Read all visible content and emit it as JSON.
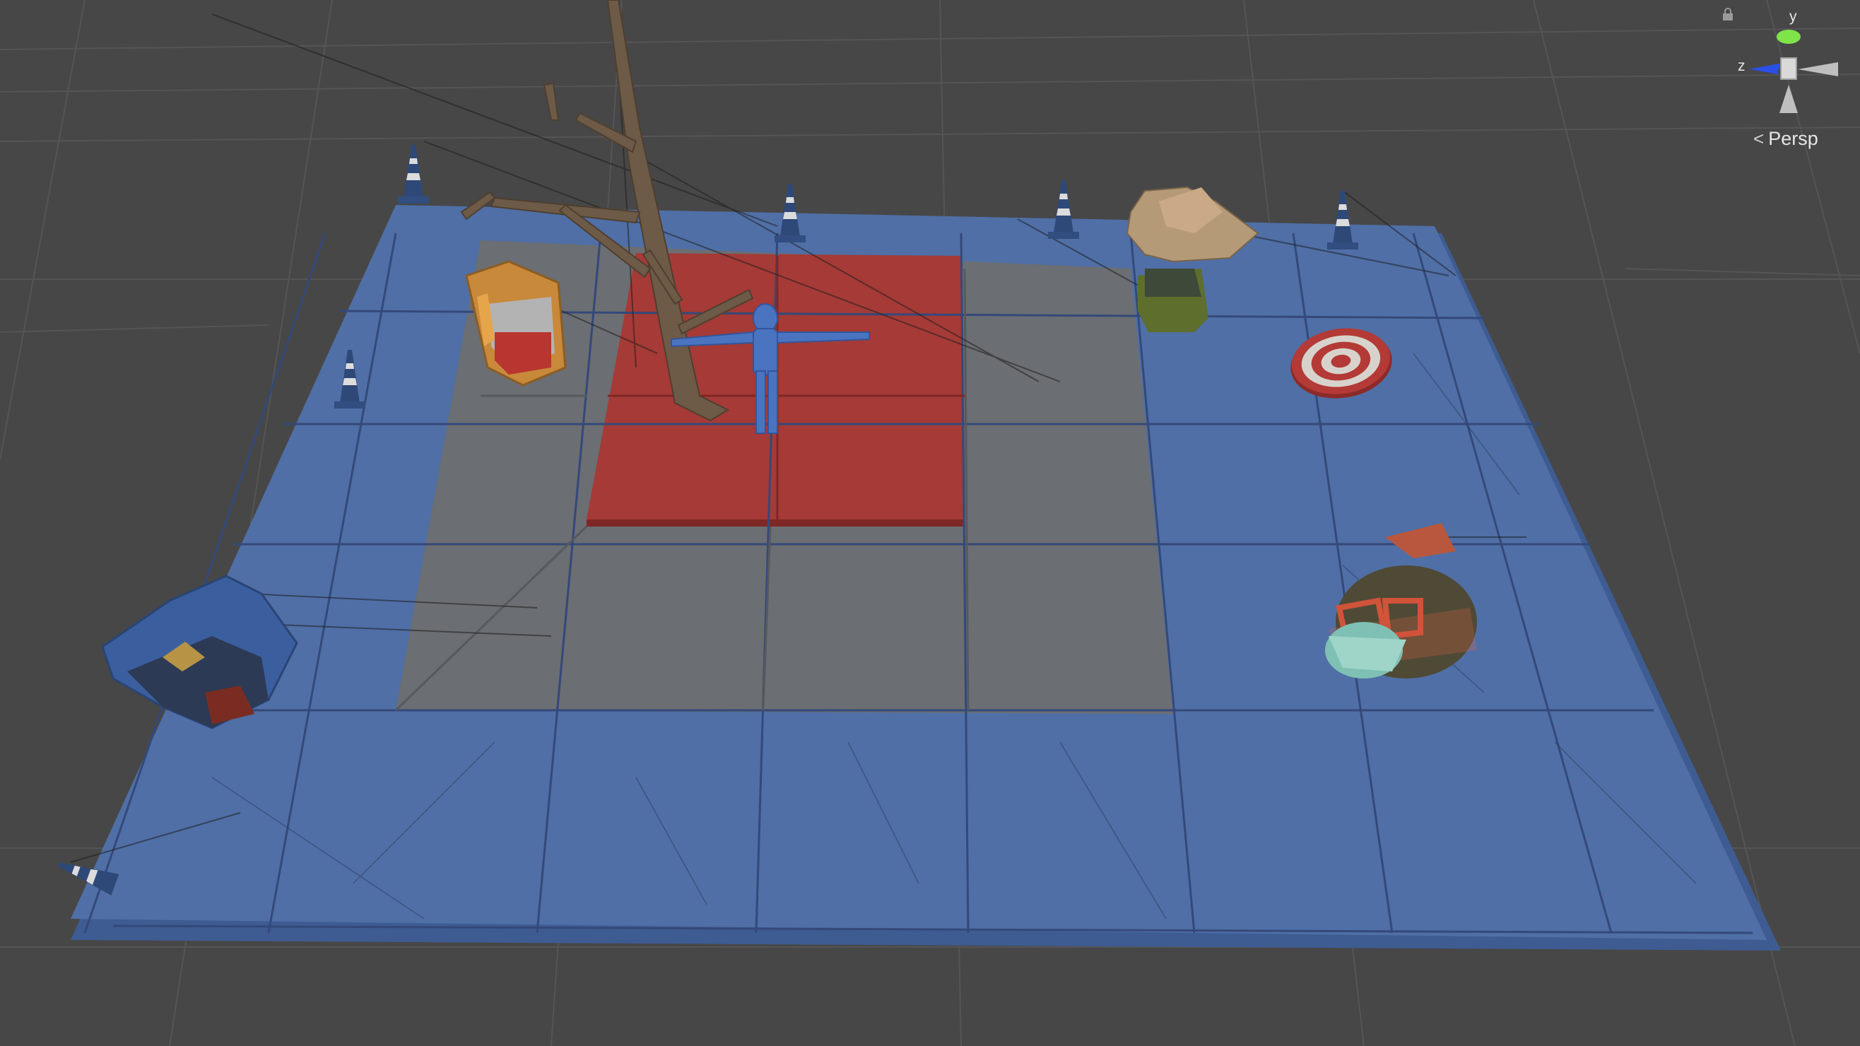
{
  "scene_view": {
    "projection_label": "Persp",
    "axes": {
      "y": "y",
      "z": "z"
    },
    "colors": {
      "background": "#474747",
      "grid_line": "#545454",
      "tile_blue": "#4f6fa6",
      "tile_gray": "#6b6e72",
      "tile_red": "#a53a36",
      "axis_y": "#7fe34a",
      "axis_z": "#2b4fe8"
    },
    "objects": [
      "traffic-cone",
      "dead-tree",
      "humanoid-character",
      "hard-hat",
      "cowboy-hat-head",
      "archery-target",
      "police-cap",
      "aviator-head"
    ]
  }
}
